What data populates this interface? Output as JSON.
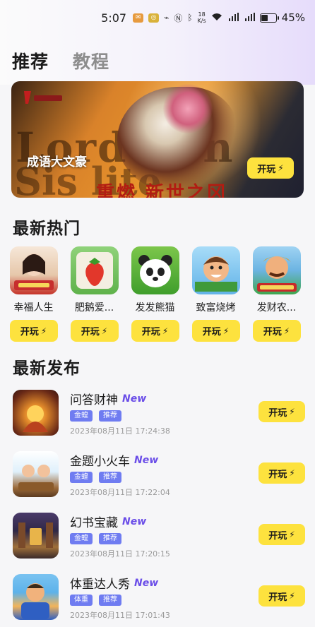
{
  "status_bar": {
    "time": "5:07",
    "speed_value": "18",
    "speed_unit": "K/s",
    "battery": "45%"
  },
  "tabs": [
    {
      "label": "推荐",
      "active": true
    },
    {
      "label": "教程",
      "active": false
    }
  ],
  "banner": {
    "game_title": "成语大文豪",
    "play_label": "开玩",
    "bg_text": "Lord Son",
    "bg_text2": "Sis  lite",
    "red_text": "重燃 新世之冈"
  },
  "hot": {
    "title": "最新热门",
    "items": [
      {
        "name": "幸福人生",
        "icon": "lady-portrait-icon",
        "play_label": "开玩"
      },
      {
        "name": "肥鹅爱...",
        "icon": "strawberry-icon",
        "play_label": "开玩"
      },
      {
        "name": "发发熊猫",
        "icon": "panda-icon",
        "play_label": "开玩"
      },
      {
        "name": "致富烧烤",
        "icon": "bbq-chef-icon",
        "play_label": "开玩"
      },
      {
        "name": "发财农...",
        "icon": "farmer-icon",
        "play_label": "开玩"
      }
    ]
  },
  "releases": {
    "title": "最新发布",
    "items": [
      {
        "name": "问答财神",
        "new_label": "New",
        "tags": [
          "金蝗",
          "推荐"
        ],
        "time": "2023年08月11日 17:24:38",
        "play_label": "开玩"
      },
      {
        "name": "金题小火车",
        "new_label": "New",
        "tags": [
          "金蝗",
          "推荐"
        ],
        "time": "2023年08月11日 17:22:04",
        "play_label": "开玩"
      },
      {
        "name": "幻书宝藏",
        "new_label": "New",
        "tags": [
          "金蝗",
          "推荐"
        ],
        "time": "2023年08月11日 17:20:15",
        "play_label": "开玩"
      },
      {
        "name": "体重达人秀",
        "new_label": "New",
        "tags": [
          "体重",
          "推荐"
        ],
        "time": "2023年08月11日 17:01:43",
        "play_label": "开玩"
      }
    ]
  },
  "colors": {
    "accent_yellow": "#fde23e",
    "tag_blue": "#6f7cf1",
    "new_purple": "#6b4ee8"
  }
}
